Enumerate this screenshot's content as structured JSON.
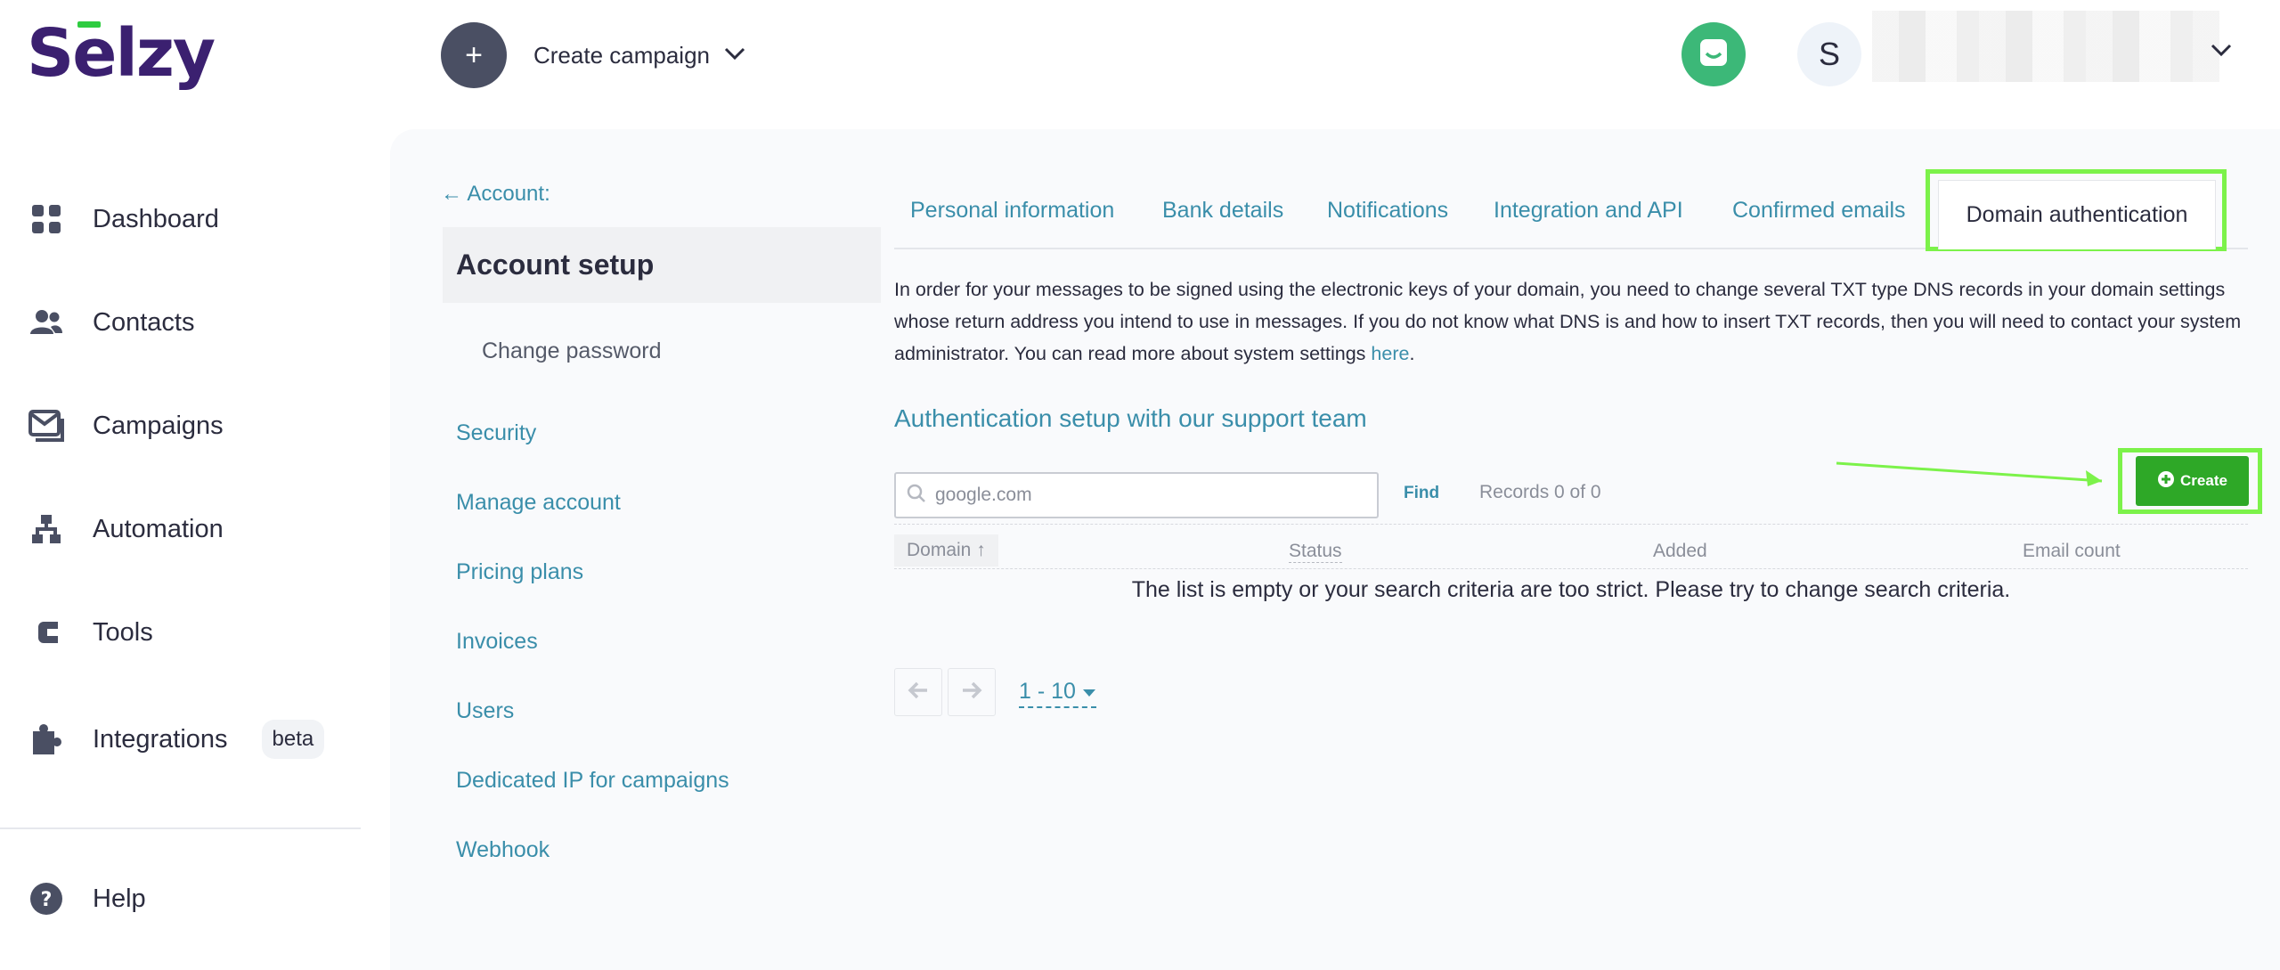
{
  "brand": {
    "logo_text": "Selzy",
    "accent": "#3b2070",
    "logo_bar_color": "#2ecc40"
  },
  "sidebar": {
    "items": [
      {
        "label": "Dashboard",
        "icon": "dashboard-icon"
      },
      {
        "label": "Contacts",
        "icon": "contacts-icon"
      },
      {
        "label": "Campaigns",
        "icon": "campaigns-icon"
      },
      {
        "label": "Automation",
        "icon": "automation-icon"
      },
      {
        "label": "Tools",
        "icon": "tools-icon"
      },
      {
        "label": "Integrations",
        "icon": "puzzle-icon",
        "badge": "beta"
      }
    ],
    "help": {
      "label": "Help",
      "icon": "help-icon"
    }
  },
  "header": {
    "create_campaign_label": "Create campaign",
    "plus_glyph": "+",
    "avatar_initial": "S"
  },
  "account_nav": {
    "back_label": "← Account:",
    "section_title": "Account setup",
    "change_password": "Change password",
    "links": [
      "Security",
      "Manage account",
      "Pricing plans",
      "Invoices",
      "Users",
      "Dedicated IP for campaigns",
      "Webhook"
    ]
  },
  "tabs": {
    "items": [
      "Personal information",
      "Bank details",
      "Notifications",
      "Integration and API",
      "Confirmed emails"
    ],
    "active": "Domain authentication"
  },
  "content": {
    "intro_text": "In order for your messages to be signed using the electronic keys of your domain, you need to change several TXT type DNS records in your domain settings whose return address you intend to use in messages. If you do not know what DNS is and how to insert TXT records, then you will need to contact your system administrator. You can read more about system settings ",
    "intro_link": "here",
    "intro_end": ".",
    "section_title": "Authentication setup with our support team"
  },
  "search": {
    "placeholder": "google.com",
    "find_label": "Find",
    "records_label": "Records 0 of 0"
  },
  "create_button": {
    "label": "Create",
    "color": "#2ea827"
  },
  "highlight_color": "#7cf24a",
  "table": {
    "columns": [
      "Domain ↑",
      "Status",
      "Added",
      "Email count"
    ],
    "empty_message": "The list is empty or your search criteria are too strict. Please try to change search criteria."
  },
  "pagination": {
    "page_size_label": "1 - 10"
  },
  "colors": {
    "link": "#3a8eaa",
    "text": "#2b2c3e",
    "chat_green": "#3cb878"
  }
}
